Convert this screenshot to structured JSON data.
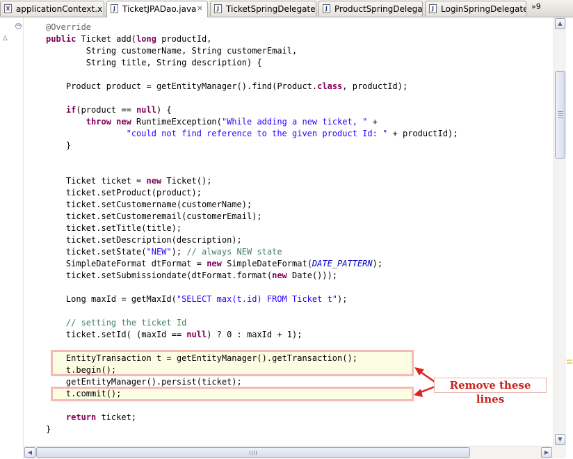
{
  "tabs": [
    {
      "icon": "X",
      "label": "applicationContext.x",
      "active": false
    },
    {
      "icon": "J",
      "label": "TicketJPADao.java",
      "active": true,
      "close": "×"
    },
    {
      "icon": "J",
      "label": "TicketSpringDelegate",
      "active": false
    },
    {
      "icon": "J",
      "label": "ProductSpringDelegat",
      "active": false
    },
    {
      "icon": "J",
      "label": "LoginSpringDelegate.",
      "active": false
    }
  ],
  "overflow_label": "»9",
  "code": {
    "lines": [
      [
        {
          "t": "@Override",
          "c": "ann"
        }
      ],
      [
        {
          "t": "public ",
          "c": "kw"
        },
        {
          "t": "Ticket add("
        },
        {
          "t": "long ",
          "c": "kw"
        },
        {
          "t": "productId,"
        }
      ],
      [
        {
          "t": "        String customerName, String customerEmail,"
        }
      ],
      [
        {
          "t": "        String title, String description) {"
        }
      ],
      [],
      [
        {
          "t": "    Product product = getEntityManager().find(Product."
        },
        {
          "t": "class",
          "c": "kw"
        },
        {
          "t": ", productId);"
        }
      ],
      [],
      [
        {
          "t": "    "
        },
        {
          "t": "if",
          "c": "kw"
        },
        {
          "t": "(product == "
        },
        {
          "t": "null",
          "c": "kw"
        },
        {
          "t": ") {"
        }
      ],
      [
        {
          "t": "        "
        },
        {
          "t": "throw new ",
          "c": "kw"
        },
        {
          "t": "RuntimeException("
        },
        {
          "t": "\"While adding a new ticket, \"",
          "c": "str"
        },
        {
          "t": " +"
        }
      ],
      [
        {
          "t": "                "
        },
        {
          "t": "\"could not find reference to the given product Id: \"",
          "c": "str"
        },
        {
          "t": " + productId);"
        }
      ],
      [
        {
          "t": "    }"
        }
      ],
      [],
      [],
      [
        {
          "t": "    Ticket ticket = "
        },
        {
          "t": "new ",
          "c": "kw"
        },
        {
          "t": "Ticket();"
        }
      ],
      [
        {
          "t": "    ticket.setProduct(product);"
        }
      ],
      [
        {
          "t": "    ticket.setCustomername(customerName);"
        }
      ],
      [
        {
          "t": "    ticket.setCustomeremail(customerEmail);"
        }
      ],
      [
        {
          "t": "    ticket.setTitle(title);"
        }
      ],
      [
        {
          "t": "    ticket.setDescription(description);"
        }
      ],
      [
        {
          "t": "    ticket.setState("
        },
        {
          "t": "\"NEW\"",
          "c": "str"
        },
        {
          "t": "); "
        },
        {
          "t": "// always NEW state",
          "c": "cm"
        }
      ],
      [
        {
          "t": "    SimpleDateFormat dtFormat = "
        },
        {
          "t": "new ",
          "c": "kw"
        },
        {
          "t": "SimpleDateFormat("
        },
        {
          "t": "DATE_PATTERN",
          "c": "fld"
        },
        {
          "t": ");"
        }
      ],
      [
        {
          "t": "    ticket.setSubmissiondate(dtFormat.format("
        },
        {
          "t": "new ",
          "c": "kw"
        },
        {
          "t": "Date()));"
        }
      ],
      [],
      [
        {
          "t": "    Long maxId = getMaxId("
        },
        {
          "t": "\"SELECT max(t.id) FROM Ticket t\"",
          "c": "str"
        },
        {
          "t": ");"
        }
      ],
      [],
      [
        {
          "t": "    "
        },
        {
          "t": "// setting the ticket Id",
          "c": "cm"
        }
      ],
      [
        {
          "t": "    ticket.setId( (maxId == "
        },
        {
          "t": "null",
          "c": "kw"
        },
        {
          "t": ") ? 0 : maxId + 1);"
        }
      ],
      [],
      [
        {
          "t": "    EntityTransaction t = getEntityManager().getTransaction();"
        }
      ],
      [
        {
          "t": "    t.begin();"
        }
      ],
      [
        {
          "t": "    getEntityManager().persist(ticket);"
        }
      ],
      [
        {
          "t": "    t.commit();"
        }
      ],
      [],
      [
        {
          "t": "    "
        },
        {
          "t": "return ",
          "c": "kw"
        },
        {
          "t": "ticket;"
        }
      ],
      [
        {
          "t": "}"
        }
      ],
      [],
      [
        {
          "t": "@"
        }
      ]
    ]
  },
  "annotation": {
    "label": "Remove these lines",
    "color": "#c8241c"
  },
  "colors": {
    "keyword": "#7f0055",
    "string": "#2a00ff",
    "comment": "#3f7f5f",
    "annotation": "#646464",
    "constant": "#0000c0",
    "highlight_border": "#f6b9b3"
  }
}
